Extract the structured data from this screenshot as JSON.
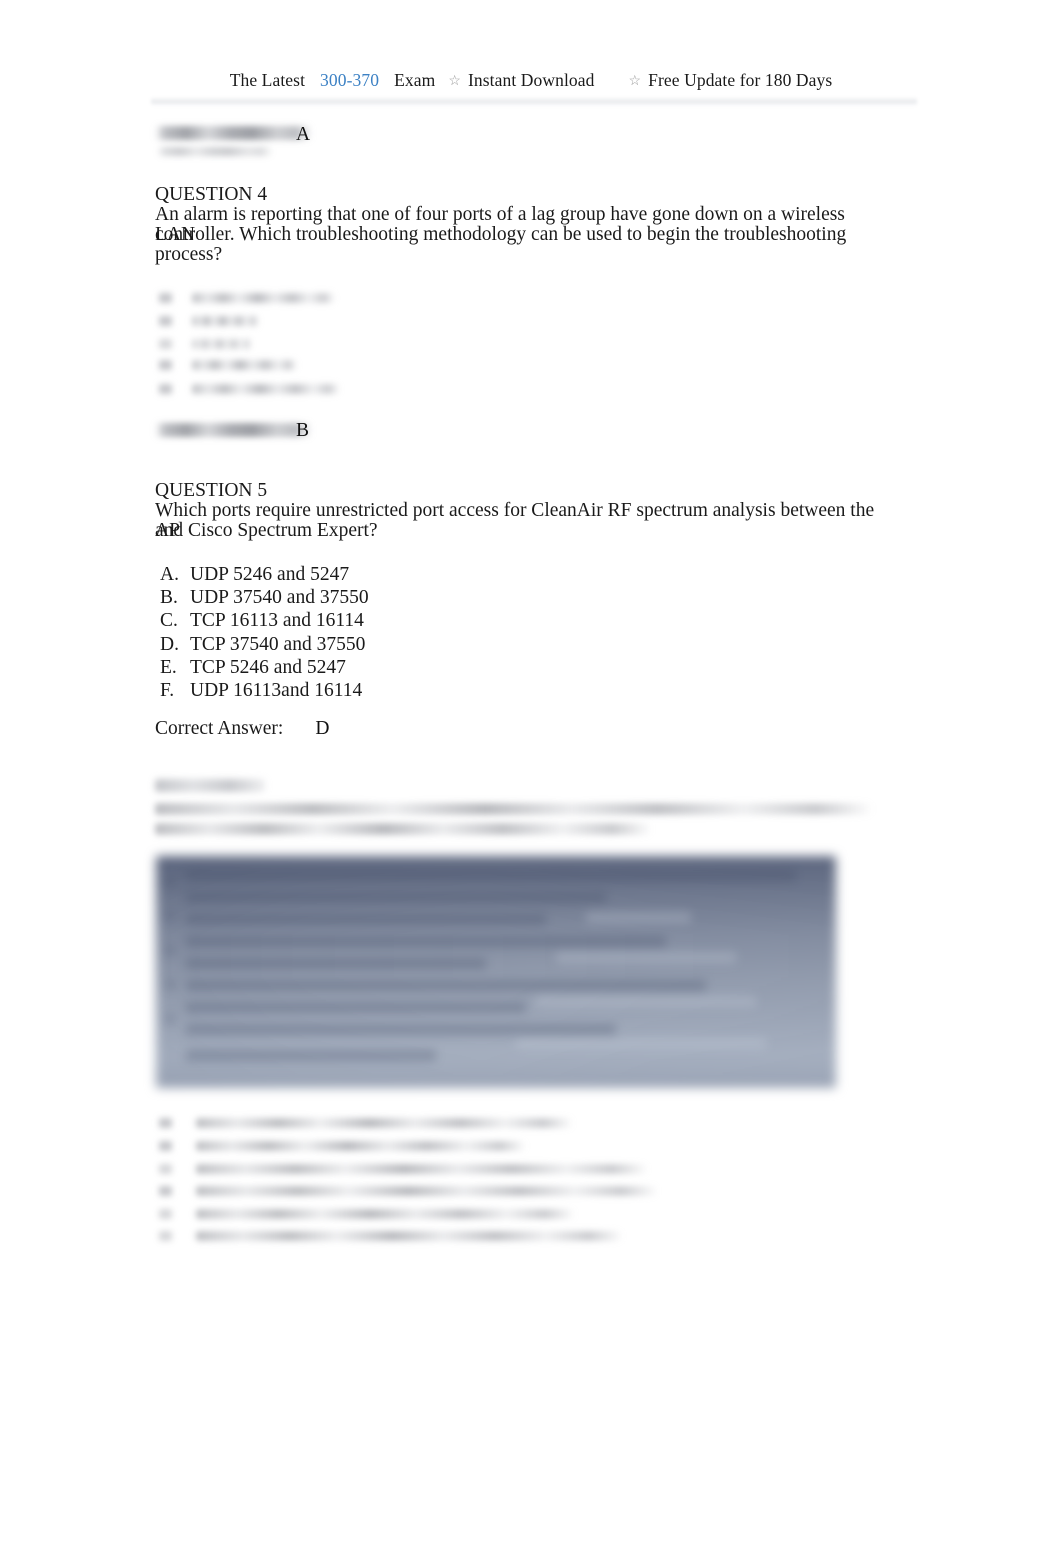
{
  "document": {
    "type": "exam-dump-pdf-page",
    "page_background": "#ffffff",
    "link_color": "#3c81c4",
    "text_color": "#1a1a1a"
  },
  "header": {
    "latest_label": "The Latest",
    "exam_code": "300-370",
    "exam_label": "Exam",
    "star_glyph": "☆",
    "instant_download": "Instant Download",
    "free_update": "Free Update for 180 Days"
  },
  "answer_top": {
    "label": "Correct Answer:",
    "label_redacted": true,
    "value": "A"
  },
  "question4": {
    "number_label": "QUESTION 4",
    "body": "An alarm is reporting that one of four ports of a lag group have gone down on a wireless LAN controller. Which troubleshooting methodology can be used to begin the troubleshooting process?",
    "body_lines": [
      "An alarm is reporting that one of four ports of a lag group have gone down on a wireless LAN",
      "controller. Which troubleshooting methodology can be used to begin the troubleshooting",
      "process?"
    ],
    "options_redacted": true,
    "options_count": 5,
    "answer": {
      "label": "Correct Answer:",
      "label_redacted": true,
      "value": "B"
    }
  },
  "question5": {
    "number_label": "QUESTION 5",
    "body_lines": [
      "Which ports require unrestricted port access for CleanAir RF spectrum analysis between the AP",
      "and Cisco Spectrum Expert?"
    ],
    "options": [
      {
        "letter": "A.",
        "text": "UDP 5246 and 5247"
      },
      {
        "letter": "B.",
        "text": "UDP 37540 and 37550"
      },
      {
        "letter": "C.",
        "text": "TCP 16113 and 16114"
      },
      {
        "letter": "D.",
        "text": "TCP 37540 and 37550"
      },
      {
        "letter": "E.",
        "text": "TCP 5246 and 5247"
      },
      {
        "letter": "F.",
        "text": "UDP 16113and 16114"
      }
    ],
    "answer": {
      "label": "Correct Answer:",
      "value": "D"
    }
  },
  "question6": {
    "number_label_redacted": true,
    "body_redacted": true,
    "body_line_count": 2,
    "exhibit": {
      "kind": "terminal-screenshot",
      "redacted": true,
      "dominant_colors": [
        "#5a647b",
        "#8a94a7",
        "#a1abbc",
        "#ced6e2"
      ]
    },
    "options_redacted": true,
    "options_count": 6
  }
}
